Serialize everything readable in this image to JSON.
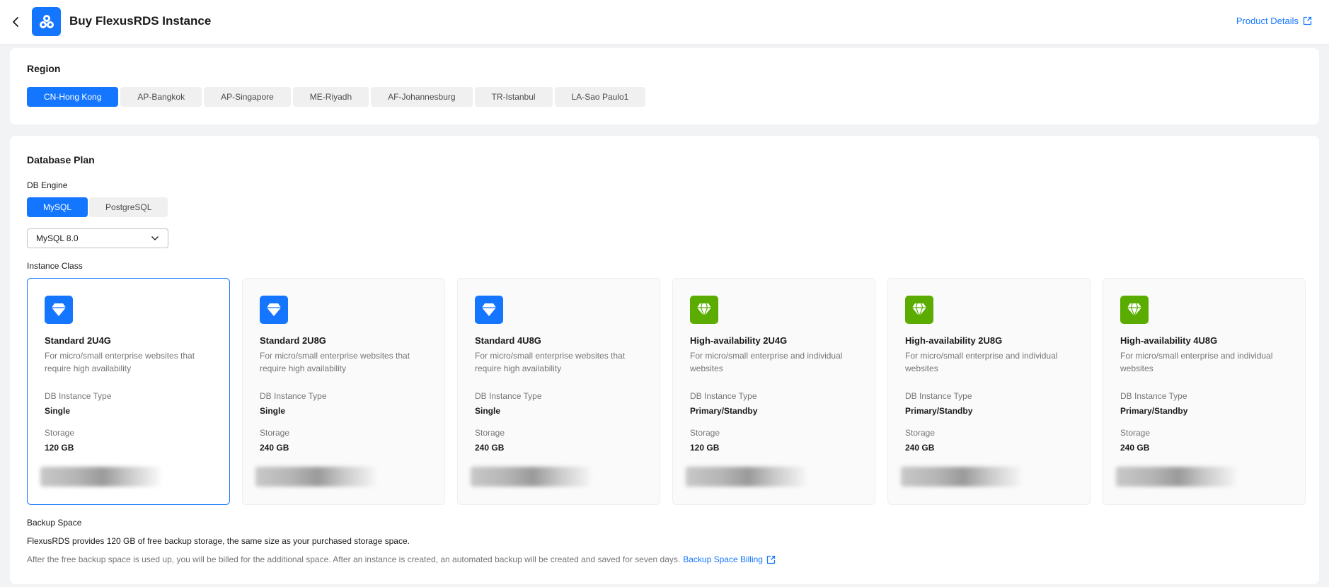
{
  "header": {
    "title": "Buy FlexusRDS Instance",
    "product_details": "Product Details"
  },
  "region": {
    "title": "Region",
    "tabs": [
      {
        "label": "CN-Hong Kong",
        "active": true
      },
      {
        "label": "AP-Bangkok"
      },
      {
        "label": "AP-Singapore"
      },
      {
        "label": "ME-Riyadh"
      },
      {
        "label": "AF-Johannesburg"
      },
      {
        "label": "TR-Istanbul"
      },
      {
        "label": "LA-Sao Paulo1"
      }
    ]
  },
  "plan": {
    "title": "Database Plan",
    "engine_label": "DB Engine",
    "engines": [
      {
        "label": "MySQL",
        "active": true
      },
      {
        "label": "PostgreSQL"
      }
    ],
    "version": "MySQL 8.0",
    "instance_class_label": "Instance Class",
    "instances": [
      {
        "name": "Standard 2U4G",
        "desc": "For micro/small enterprise websites that require high availability",
        "type_label": "DB Instance Type",
        "type": "Single",
        "storage_label": "Storage",
        "storage": "120 GB",
        "icon": "diamond-icon",
        "icon_color": "#1476ff",
        "selected": true
      },
      {
        "name": "Standard 2U8G",
        "desc": "For micro/small enterprise websites that require high availability",
        "type_label": "DB Instance Type",
        "type": "Single",
        "storage_label": "Storage",
        "storage": "240 GB",
        "icon": "diamond-icon",
        "icon_color": "#1476ff"
      },
      {
        "name": "Standard 4U8G",
        "desc": "For micro/small enterprise websites that require high availability",
        "type_label": "DB Instance Type",
        "type": "Single",
        "storage_label": "Storage",
        "storage": "240 GB",
        "icon": "diamond-icon",
        "icon_color": "#1476ff"
      },
      {
        "name": "High-availability 2U4G",
        "desc": "For micro/small enterprise and individual websites",
        "type_label": "DB Instance Type",
        "type": "Primary/Standby",
        "storage_label": "Storage",
        "storage": "120 GB",
        "icon": "diamond-icon",
        "icon_color": "#5aad00"
      },
      {
        "name": "High-availability 2U8G",
        "desc": "For micro/small enterprise and individual websites",
        "type_label": "DB Instance Type",
        "type": "Primary/Standby",
        "storage_label": "Storage",
        "storage": "240 GB",
        "icon": "diamond-icon",
        "icon_color": "#5aad00"
      },
      {
        "name": "High-availability 4U8G",
        "desc": "For micro/small enterprise and individual websites",
        "type_label": "DB Instance Type",
        "type": "Primary/Standby",
        "storage_label": "Storage",
        "storage": "240 GB",
        "icon": "diamond-icon",
        "icon_color": "#5aad00"
      }
    ],
    "backup_label": "Backup Space",
    "backup_text": "FlexusRDS provides 120 GB of free backup storage, the same size as your purchased storage space.",
    "backup_note": "After the free backup space is used up, you will be billed for the additional space. After an instance is created, an automated backup will be created and saved for seven days.",
    "backup_link": "Backup Space Billing"
  },
  "colors": {
    "accent": "#1476ff",
    "ha_green": "#5aad00"
  }
}
